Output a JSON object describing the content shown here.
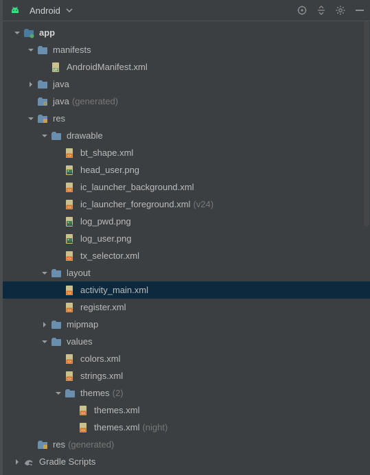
{
  "toolbar": {
    "view_label": "Android"
  },
  "tree": {
    "root": [
      {
        "id": "app",
        "label": "app",
        "icon": "module",
        "bold": true,
        "expanded": true,
        "children": [
          {
            "id": "manifests",
            "label": "manifests",
            "icon": "folder",
            "expanded": true,
            "children": [
              {
                "id": "androidmanifest",
                "label": "AndroidManifest.xml",
                "icon": "manifest"
              }
            ]
          },
          {
            "id": "java",
            "label": "java",
            "icon": "folder",
            "expanded": false,
            "children": []
          },
          {
            "id": "java-gen",
            "label": "java",
            "suffix": "(generated)",
            "icon": "folder-gen"
          },
          {
            "id": "res",
            "label": "res",
            "icon": "folder-res",
            "expanded": true,
            "children": [
              {
                "id": "drawable",
                "label": "drawable",
                "icon": "folder",
                "expanded": true,
                "children": [
                  {
                    "id": "bt-shape",
                    "label": "bt_shape.xml",
                    "icon": "xml-orange"
                  },
                  {
                    "id": "head-user",
                    "label": "head_user.png",
                    "icon": "image"
                  },
                  {
                    "id": "ic-bg",
                    "label": "ic_launcher_background.xml",
                    "icon": "xml-orange"
                  },
                  {
                    "id": "ic-fg",
                    "label": "ic_launcher_foreground.xml",
                    "suffix": "(v24)",
                    "icon": "xml-orange"
                  },
                  {
                    "id": "log-pwd",
                    "label": "log_pwd.png",
                    "icon": "image"
                  },
                  {
                    "id": "log-user",
                    "label": "log_user.png",
                    "icon": "image"
                  },
                  {
                    "id": "tx-selector",
                    "label": "tx_selector.xml",
                    "icon": "xml-orange"
                  }
                ]
              },
              {
                "id": "layout",
                "label": "layout",
                "icon": "folder",
                "expanded": true,
                "children": [
                  {
                    "id": "activity-main",
                    "label": "activity_main.xml",
                    "icon": "xml-orange",
                    "selected": true
                  },
                  {
                    "id": "register",
                    "label": "register.xml",
                    "icon": "xml-orange"
                  }
                ]
              },
              {
                "id": "mipmap",
                "label": "mipmap",
                "icon": "folder",
                "expanded": false,
                "children": []
              },
              {
                "id": "values",
                "label": "values",
                "icon": "folder",
                "expanded": true,
                "children": [
                  {
                    "id": "colors",
                    "label": "colors.xml",
                    "icon": "xml-orange"
                  },
                  {
                    "id": "strings",
                    "label": "strings.xml",
                    "icon": "xml-orange"
                  },
                  {
                    "id": "themes-dir",
                    "label": "themes",
                    "suffix": "(2)",
                    "icon": "folder",
                    "expanded": true,
                    "children": [
                      {
                        "id": "themes1",
                        "label": "themes.xml",
                        "icon": "xml-orange"
                      },
                      {
                        "id": "themes2",
                        "label": "themes.xml",
                        "suffix": "(night)",
                        "icon": "xml-orange"
                      }
                    ]
                  }
                ]
              }
            ]
          },
          {
            "id": "res-gen",
            "label": "res",
            "suffix": "(generated)",
            "icon": "folder-res-gen"
          }
        ]
      },
      {
        "id": "gradle-scripts",
        "label": "Gradle Scripts",
        "icon": "gradle",
        "expanded": false,
        "children": []
      }
    ]
  }
}
